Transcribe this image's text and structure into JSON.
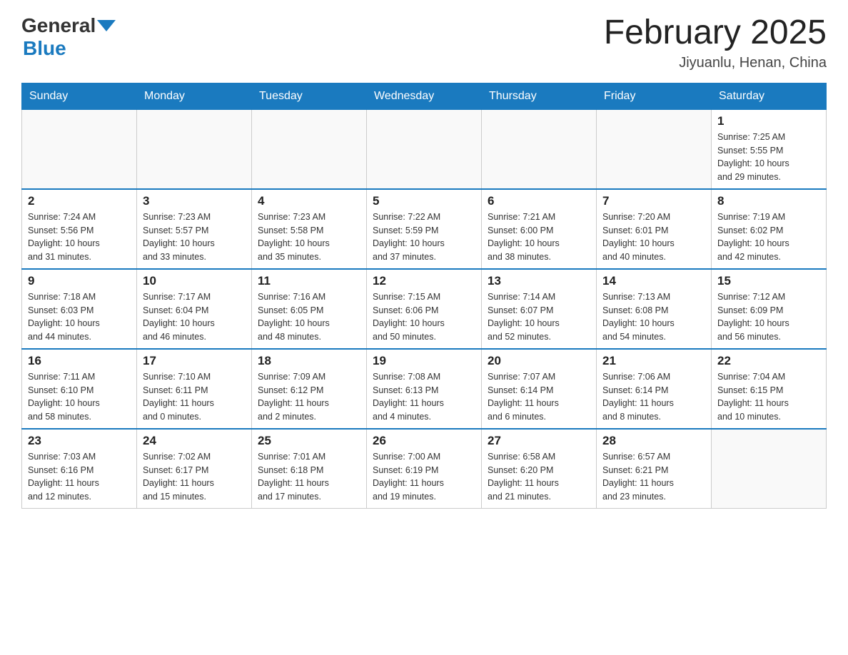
{
  "header": {
    "logo_general": "General",
    "logo_blue": "Blue",
    "month_title": "February 2025",
    "location": "Jiyuanlu, Henan, China"
  },
  "days_of_week": [
    "Sunday",
    "Monday",
    "Tuesday",
    "Wednesday",
    "Thursday",
    "Friday",
    "Saturday"
  ],
  "weeks": [
    [
      {
        "day": "",
        "info": ""
      },
      {
        "day": "",
        "info": ""
      },
      {
        "day": "",
        "info": ""
      },
      {
        "day": "",
        "info": ""
      },
      {
        "day": "",
        "info": ""
      },
      {
        "day": "",
        "info": ""
      },
      {
        "day": "1",
        "info": "Sunrise: 7:25 AM\nSunset: 5:55 PM\nDaylight: 10 hours\nand 29 minutes."
      }
    ],
    [
      {
        "day": "2",
        "info": "Sunrise: 7:24 AM\nSunset: 5:56 PM\nDaylight: 10 hours\nand 31 minutes."
      },
      {
        "day": "3",
        "info": "Sunrise: 7:23 AM\nSunset: 5:57 PM\nDaylight: 10 hours\nand 33 minutes."
      },
      {
        "day": "4",
        "info": "Sunrise: 7:23 AM\nSunset: 5:58 PM\nDaylight: 10 hours\nand 35 minutes."
      },
      {
        "day": "5",
        "info": "Sunrise: 7:22 AM\nSunset: 5:59 PM\nDaylight: 10 hours\nand 37 minutes."
      },
      {
        "day": "6",
        "info": "Sunrise: 7:21 AM\nSunset: 6:00 PM\nDaylight: 10 hours\nand 38 minutes."
      },
      {
        "day": "7",
        "info": "Sunrise: 7:20 AM\nSunset: 6:01 PM\nDaylight: 10 hours\nand 40 minutes."
      },
      {
        "day": "8",
        "info": "Sunrise: 7:19 AM\nSunset: 6:02 PM\nDaylight: 10 hours\nand 42 minutes."
      }
    ],
    [
      {
        "day": "9",
        "info": "Sunrise: 7:18 AM\nSunset: 6:03 PM\nDaylight: 10 hours\nand 44 minutes."
      },
      {
        "day": "10",
        "info": "Sunrise: 7:17 AM\nSunset: 6:04 PM\nDaylight: 10 hours\nand 46 minutes."
      },
      {
        "day": "11",
        "info": "Sunrise: 7:16 AM\nSunset: 6:05 PM\nDaylight: 10 hours\nand 48 minutes."
      },
      {
        "day": "12",
        "info": "Sunrise: 7:15 AM\nSunset: 6:06 PM\nDaylight: 10 hours\nand 50 minutes."
      },
      {
        "day": "13",
        "info": "Sunrise: 7:14 AM\nSunset: 6:07 PM\nDaylight: 10 hours\nand 52 minutes."
      },
      {
        "day": "14",
        "info": "Sunrise: 7:13 AM\nSunset: 6:08 PM\nDaylight: 10 hours\nand 54 minutes."
      },
      {
        "day": "15",
        "info": "Sunrise: 7:12 AM\nSunset: 6:09 PM\nDaylight: 10 hours\nand 56 minutes."
      }
    ],
    [
      {
        "day": "16",
        "info": "Sunrise: 7:11 AM\nSunset: 6:10 PM\nDaylight: 10 hours\nand 58 minutes."
      },
      {
        "day": "17",
        "info": "Sunrise: 7:10 AM\nSunset: 6:11 PM\nDaylight: 11 hours\nand 0 minutes."
      },
      {
        "day": "18",
        "info": "Sunrise: 7:09 AM\nSunset: 6:12 PM\nDaylight: 11 hours\nand 2 minutes."
      },
      {
        "day": "19",
        "info": "Sunrise: 7:08 AM\nSunset: 6:13 PM\nDaylight: 11 hours\nand 4 minutes."
      },
      {
        "day": "20",
        "info": "Sunrise: 7:07 AM\nSunset: 6:14 PM\nDaylight: 11 hours\nand 6 minutes."
      },
      {
        "day": "21",
        "info": "Sunrise: 7:06 AM\nSunset: 6:14 PM\nDaylight: 11 hours\nand 8 minutes."
      },
      {
        "day": "22",
        "info": "Sunrise: 7:04 AM\nSunset: 6:15 PM\nDaylight: 11 hours\nand 10 minutes."
      }
    ],
    [
      {
        "day": "23",
        "info": "Sunrise: 7:03 AM\nSunset: 6:16 PM\nDaylight: 11 hours\nand 12 minutes."
      },
      {
        "day": "24",
        "info": "Sunrise: 7:02 AM\nSunset: 6:17 PM\nDaylight: 11 hours\nand 15 minutes."
      },
      {
        "day": "25",
        "info": "Sunrise: 7:01 AM\nSunset: 6:18 PM\nDaylight: 11 hours\nand 17 minutes."
      },
      {
        "day": "26",
        "info": "Sunrise: 7:00 AM\nSunset: 6:19 PM\nDaylight: 11 hours\nand 19 minutes."
      },
      {
        "day": "27",
        "info": "Sunrise: 6:58 AM\nSunset: 6:20 PM\nDaylight: 11 hours\nand 21 minutes."
      },
      {
        "day": "28",
        "info": "Sunrise: 6:57 AM\nSunset: 6:21 PM\nDaylight: 11 hours\nand 23 minutes."
      },
      {
        "day": "",
        "info": ""
      }
    ]
  ]
}
